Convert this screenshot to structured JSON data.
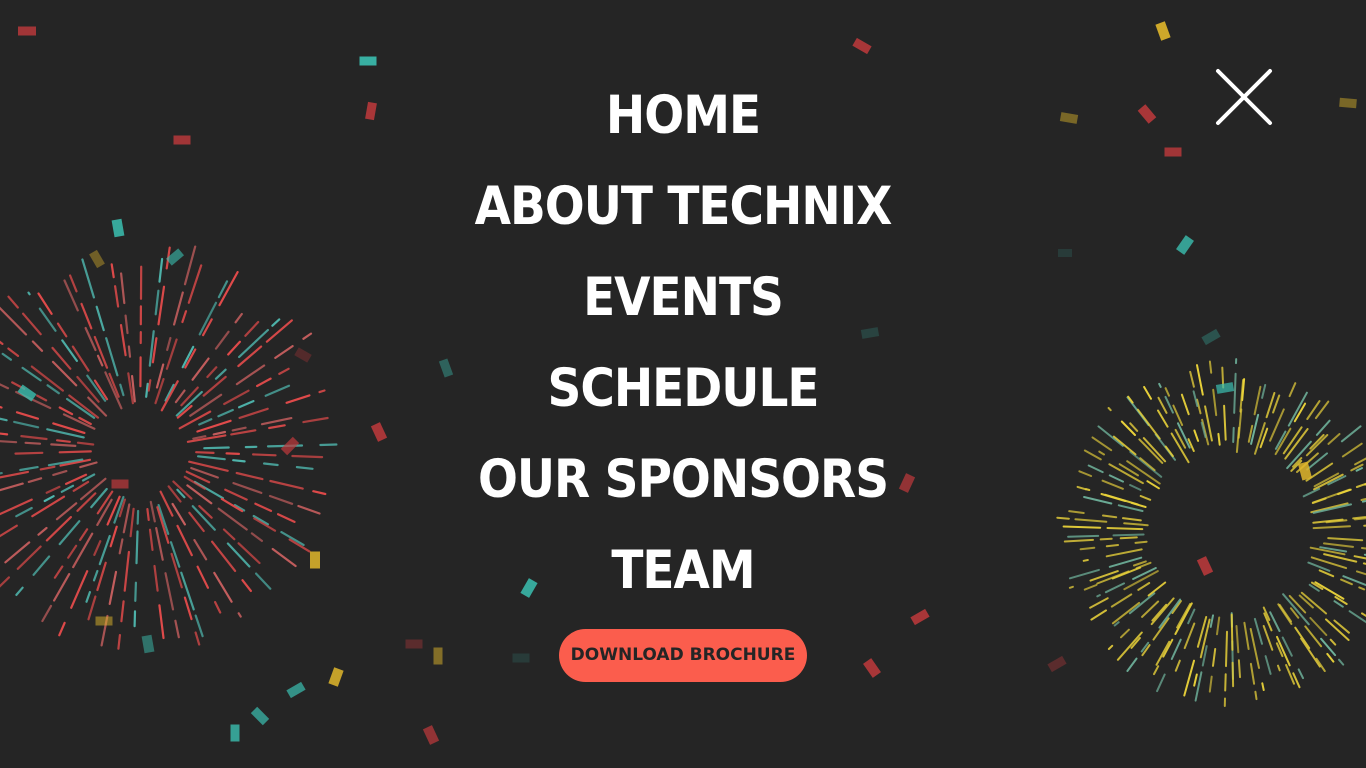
{
  "menu": {
    "items": [
      {
        "label": "HOME"
      },
      {
        "label": "ABOUT TECHNIX"
      },
      {
        "label": "EVENTS"
      },
      {
        "label": "SCHEDULE"
      },
      {
        "label": "OUR SPONSORS"
      },
      {
        "label": "TEAM"
      }
    ]
  },
  "cta": {
    "label": "DOWNLOAD BROCHURE"
  },
  "icons": {
    "close": "close-icon"
  },
  "colors": {
    "background": "#252525",
    "text": "#ffffff",
    "accent": "#fb5d4d",
    "confetti_red": "#c0393c",
    "confetti_teal": "#3bbfb0",
    "confetti_yellow": "#e1b72b",
    "firework_yellow": "#e9d23a"
  }
}
